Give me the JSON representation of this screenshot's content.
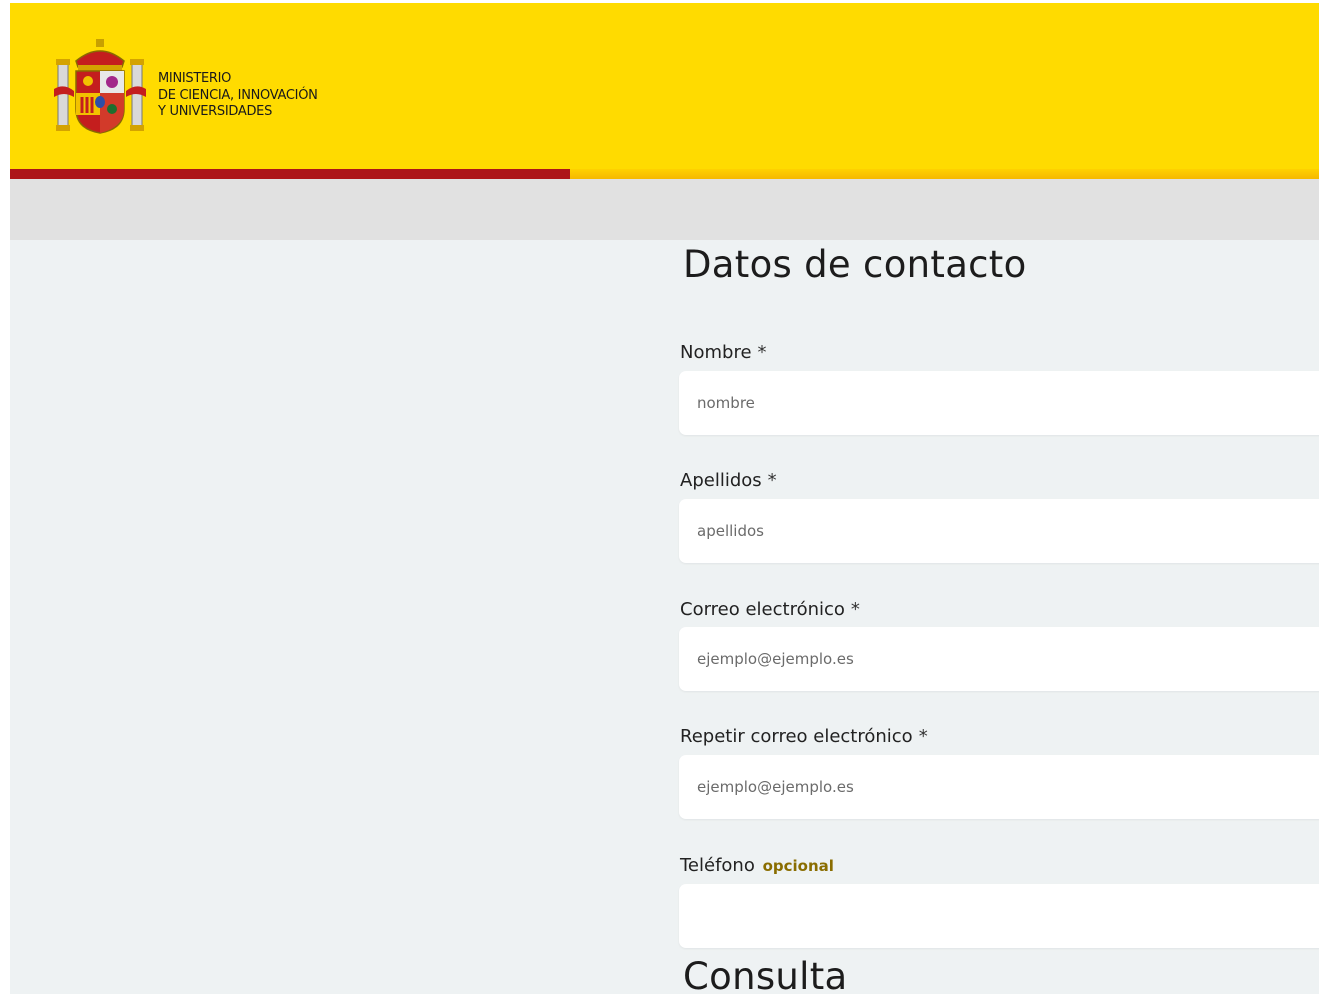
{
  "header": {
    "ministry_lines": [
      "MINISTERIO",
      "DE CIENCIA, INNOVACIÓN",
      "Y UNIVERSIDADES"
    ],
    "colors": {
      "yellow": "#ffdb00",
      "red": "#ad1519",
      "subnav": "#e1e1e1"
    },
    "crest_icon": "coat-of-arms-spain"
  },
  "contact": {
    "title": "Datos de contacto",
    "fields": [
      {
        "label": "Nombre",
        "required": "*",
        "placeholder": "nombre"
      },
      {
        "label": "Apellidos",
        "required": "*",
        "placeholder": "apellidos"
      },
      {
        "label": "Correo electrónico",
        "required": "*",
        "placeholder": "ejemplo@ejemplo.es"
      },
      {
        "label": "Repetir correo electrónico",
        "required": "*",
        "placeholder": "ejemplo@ejemplo.es"
      },
      {
        "label": "Teléfono",
        "optional": "opcional",
        "placeholder": ""
      }
    ]
  },
  "consulta": {
    "title": "Consulta"
  }
}
